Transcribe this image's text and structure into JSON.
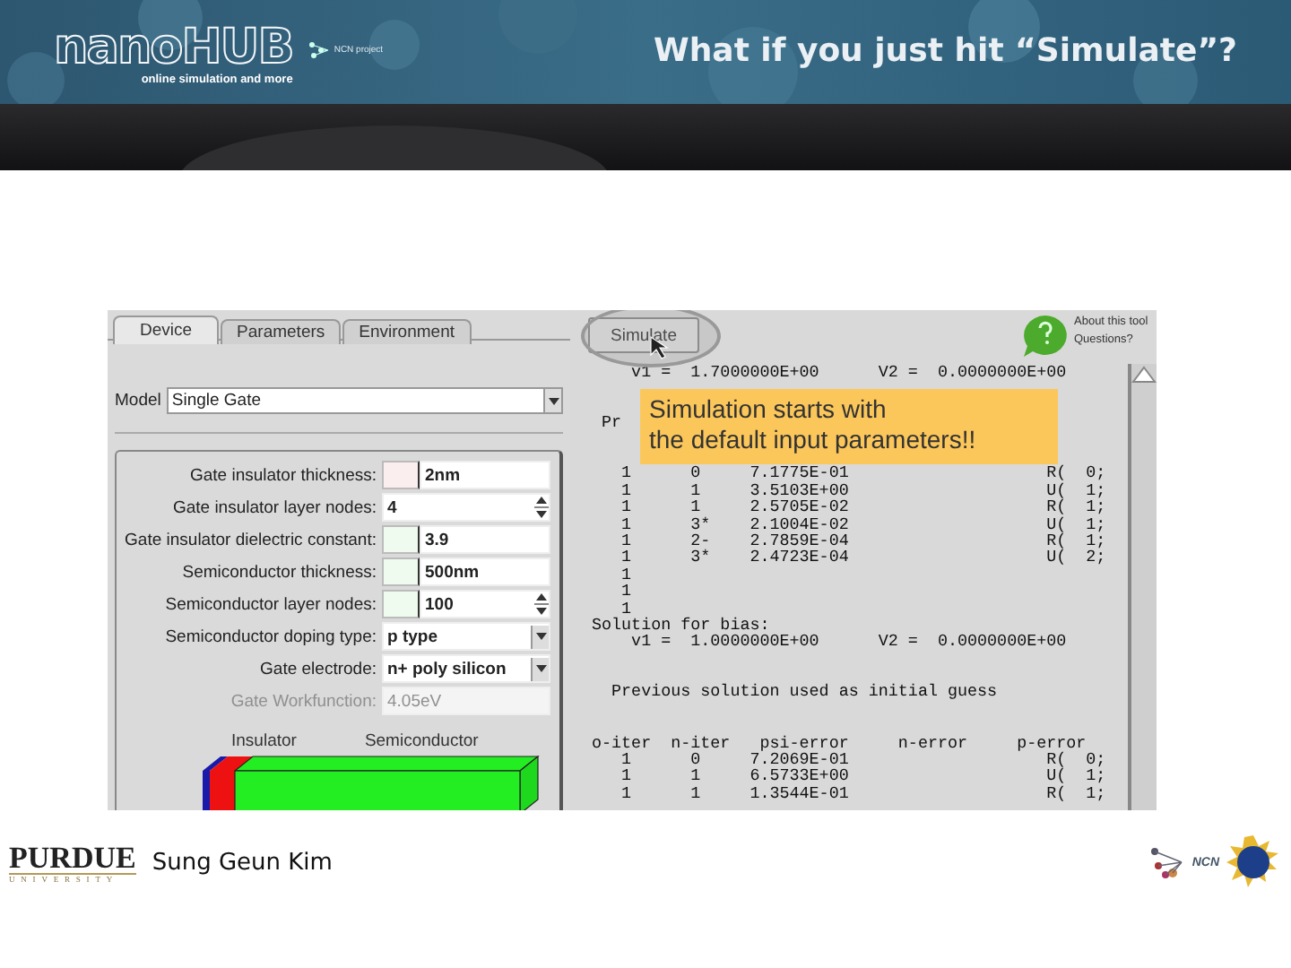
{
  "header": {
    "logo": "nanoHUB",
    "tagline": "online simulation and more",
    "partner": "NCN project",
    "title": "What if you just hit “Simulate”?"
  },
  "tool": {
    "tabs": [
      {
        "label": "Device",
        "selected": true
      },
      {
        "label": "Parameters",
        "selected": false
      },
      {
        "label": "Environment",
        "selected": false
      }
    ],
    "model": {
      "label": "Model",
      "value": "Single Gate"
    },
    "fields": [
      {
        "kind": "text",
        "label": "Gate insulator thickness:",
        "color": "#fbeeee",
        "value": "2nm",
        "disabled": false
      },
      {
        "kind": "spinner",
        "label": "Gate insulator layer nodes:",
        "value": "4",
        "disabled": false
      },
      {
        "kind": "text",
        "label": "Gate insulator dielectric constant:",
        "color": "#eefbee",
        "value": "3.9",
        "disabled": false
      },
      {
        "kind": "text",
        "label": "Semiconductor thickness:",
        "color": "#eefbee",
        "value": "500nm",
        "disabled": false
      },
      {
        "kind": "spinner",
        "label": "Semiconductor layer nodes:",
        "color": "#eefbee",
        "value": "100",
        "disabled": false
      },
      {
        "kind": "dropdown",
        "label": "Semiconductor doping type:",
        "value": "p type",
        "disabled": false
      },
      {
        "kind": "dropdown",
        "label": "Gate electrode:",
        "value": "n+ poly silicon",
        "disabled": false
      },
      {
        "kind": "text",
        "label": "Gate Workfunction:",
        "value": "4.05eV",
        "disabled": true
      }
    ],
    "diagram_labels": [
      "Insulator",
      "Semiconductor"
    ],
    "simulate_button": "Simulate",
    "help": {
      "about": "About this tool",
      "questions": "Questions?"
    },
    "output_blocks": [
      [
        "    v1 =  1.7000000E+00      V2 =  0.0000000E+00"
      ],
      [
        " Pr"
      ],
      [
        "   1      0     7.1775E-01                    R(  0;",
        "   1      1     3.5103E+00                    U(  1;",
        "   1      1     2.5705E-02                    R(  1;",
        "   1      3*    2.1004E-02                    U(  1;",
        "   1      2-    2.7859E-04                    R(  1;",
        "   1      3*    2.4723E-04                    U(  2;",
        "   1",
        "   1",
        "   1",
        "Solution for bias:",
        "    v1 =  1.0000000E+00      V2 =  0.0000000E+00"
      ],
      [
        "  Previous solution used as initial guess"
      ],
      [
        "o-iter  n-iter   psi-error     n-error     p-error",
        "   1      0     7.2069E-01                    R(  0;",
        "   1      1     6.5733E+00                    U(  1;",
        "   1      1     1.3544E-01                    R(  1;"
      ]
    ]
  },
  "callout": [
    "Simulation starts with",
    "the default input parameters!!"
  ],
  "footer": {
    "university": "PURDUE",
    "university_sub": "UNIVERSITY",
    "author": "Sung Geun Kim",
    "partner": "NCN"
  }
}
